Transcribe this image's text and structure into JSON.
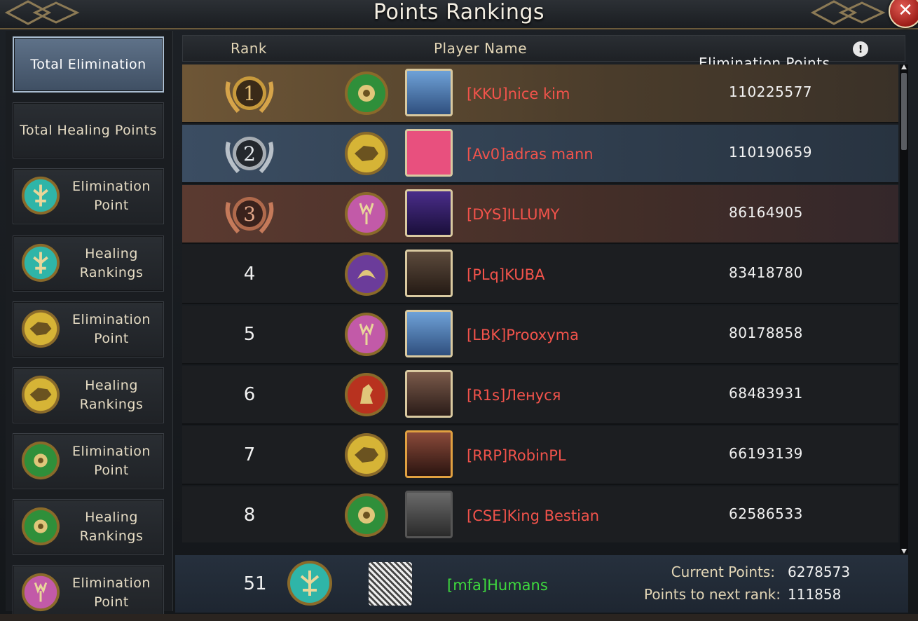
{
  "window": {
    "title": "Points Rankings",
    "close_icon": "close-icon"
  },
  "sidebar": {
    "items": [
      {
        "label": "Total Elimination",
        "active": true,
        "icon": null
      },
      {
        "label": "Total Healing Points",
        "active": false,
        "icon": null
      },
      {
        "label": "Elimination Point",
        "active": false,
        "icon": "teal-house-crest"
      },
      {
        "label": "Healing Rankings",
        "active": false,
        "icon": "teal-house-crest"
      },
      {
        "label": "Elimination Point",
        "active": false,
        "icon": "gold-wolf-crest"
      },
      {
        "label": "Healing Rankings",
        "active": false,
        "icon": "gold-wolf-crest"
      },
      {
        "label": "Elimination Point",
        "active": false,
        "icon": "green-flower-crest"
      },
      {
        "label": "Healing Rankings",
        "active": false,
        "icon": "green-flower-crest"
      },
      {
        "label": "Elimination Point",
        "active": false,
        "icon": "pink-stag-crest"
      }
    ]
  },
  "table": {
    "headers": {
      "rank": "Rank",
      "player": "Player Name",
      "points": "Elimination Points"
    },
    "rows": [
      {
        "rank": "1",
        "medal": "gold",
        "house": "green",
        "name": "[KKU]nice kim",
        "points": "110225577"
      },
      {
        "rank": "2",
        "medal": "silver",
        "house": "gold",
        "name": "[Av0]adras mann",
        "points": "110190659"
      },
      {
        "rank": "3",
        "medal": "bronze",
        "house": "pink",
        "name": "[DYS]ILLUMY",
        "points": "86164905"
      },
      {
        "rank": "4",
        "medal": null,
        "house": "purple",
        "name": "[PLq]KUBA",
        "points": "83418780"
      },
      {
        "rank": "5",
        "medal": null,
        "house": "pink",
        "name": "[LBK]Prooxyma",
        "points": "80178858"
      },
      {
        "rank": "6",
        "medal": null,
        "house": "red",
        "name": "[R1s]Ленуся",
        "points": "68483931"
      },
      {
        "rank": "7",
        "medal": null,
        "house": "gold",
        "name": "[RRP]RobinPL",
        "points": "66193139"
      },
      {
        "rank": "8",
        "medal": null,
        "house": "green",
        "name": "[CSE]King Bestian",
        "points": "62586533"
      }
    ]
  },
  "footer": {
    "rank": "51",
    "house": "teal",
    "name": "[mfa]Humans",
    "current_points_label": "Current Points:",
    "current_points": "6278573",
    "next_rank_label": "Points to next rank:",
    "next_rank": "111858"
  },
  "colors": {
    "player_name": "#f2534b",
    "self_name": "#3ed93e",
    "header_text": "#e3d6b6",
    "house_teal": "#2fb5a8",
    "house_gold": "#d6b436",
    "house_green": "#2f8f3a",
    "house_pink": "#c25aa8",
    "house_purple": "#6b3c9a",
    "house_red": "#b8321f"
  }
}
